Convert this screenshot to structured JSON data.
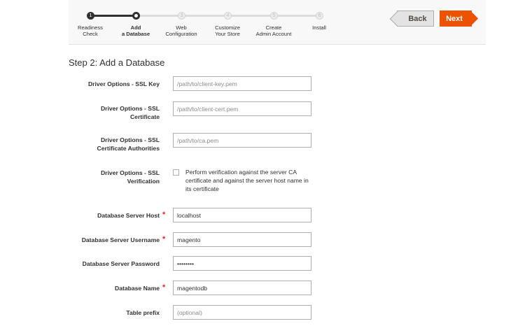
{
  "progress": {
    "steps": [
      {
        "num": "1",
        "label": "Readiness\nCheck",
        "state": "done"
      },
      {
        "num": "2",
        "label": "Add\na Database",
        "state": "current"
      },
      {
        "num": "3",
        "label": "Web\nConfiguration",
        "state": "todo"
      },
      {
        "num": "4",
        "label": "Customize\nYour Store",
        "state": "todo"
      },
      {
        "num": "5",
        "label": "Create\nAdmin Account",
        "state": "todo"
      },
      {
        "num": "6",
        "label": "Install",
        "state": "todo"
      }
    ]
  },
  "nav": {
    "back_label": "Back",
    "next_label": "Next"
  },
  "page": {
    "title": "Step 2: Add a Database"
  },
  "form": {
    "ssl_key": {
      "label": "Driver Options - SSL Key",
      "value": "",
      "placeholder": "/path/to/client-key.pem"
    },
    "ssl_cert": {
      "label": "Driver Options - SSL\nCertificate",
      "value": "",
      "placeholder": "/path/to/client-cert.pem"
    },
    "ssl_ca": {
      "label": "Driver Options - SSL\nCertificate Authorities",
      "value": "",
      "placeholder": "/path/to/ca.pem"
    },
    "ssl_verify": {
      "label": "Driver Options - SSL\nVerification",
      "checkbox_text": "Perform verification against the server CA certificate and against the server host name in its certificate",
      "checked": false
    },
    "db_host": {
      "label": "Database Server Host",
      "value": "localhost",
      "required": true
    },
    "db_user": {
      "label": "Database Server Username",
      "value": "magento",
      "required": true
    },
    "db_password": {
      "label": "Database Server Password",
      "value": "••••••••",
      "required": false
    },
    "db_name": {
      "label": "Database Name",
      "value": "magentodb",
      "required": true
    },
    "table_prefix": {
      "label": "Table prefix",
      "value": "",
      "placeholder": "(optional)"
    },
    "required_mark": "*"
  },
  "colors": {
    "accent": "#eb5202",
    "required": "#e22626",
    "progress_done": "#303030"
  }
}
